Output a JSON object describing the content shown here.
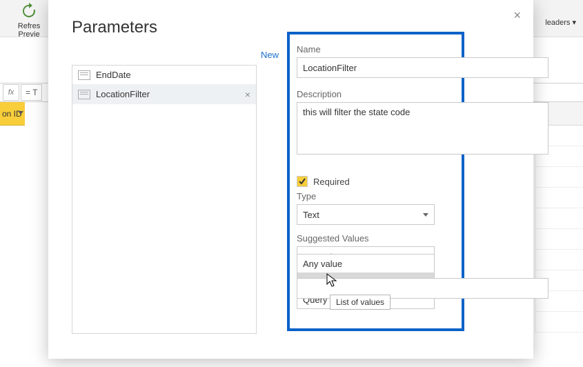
{
  "ribbon": {
    "refresh_label_line1": "Refres",
    "refresh_label_line2": "Previe",
    "headers_label": "leaders ▾"
  },
  "sheet": {
    "fx": "fx",
    "formula": "= T",
    "col_header": "on ID"
  },
  "dialog": {
    "title": "Parameters",
    "new_link": "New",
    "close": "×"
  },
  "params": [
    {
      "label": "EndDate",
      "selected": false
    },
    {
      "label": "LocationFilter",
      "selected": true
    }
  ],
  "form": {
    "name_label": "Name",
    "name_value": "LocationFilter",
    "desc_label": "Description",
    "desc_value": "this will filter the state code",
    "required_label": "Required",
    "type_label": "Type",
    "type_value": "Text",
    "sugg_label": "Suggested Values",
    "sugg_value": "Any value",
    "sugg_options": [
      "Any value",
      "List of values",
      "Query"
    ],
    "tooltip": "List of values"
  }
}
